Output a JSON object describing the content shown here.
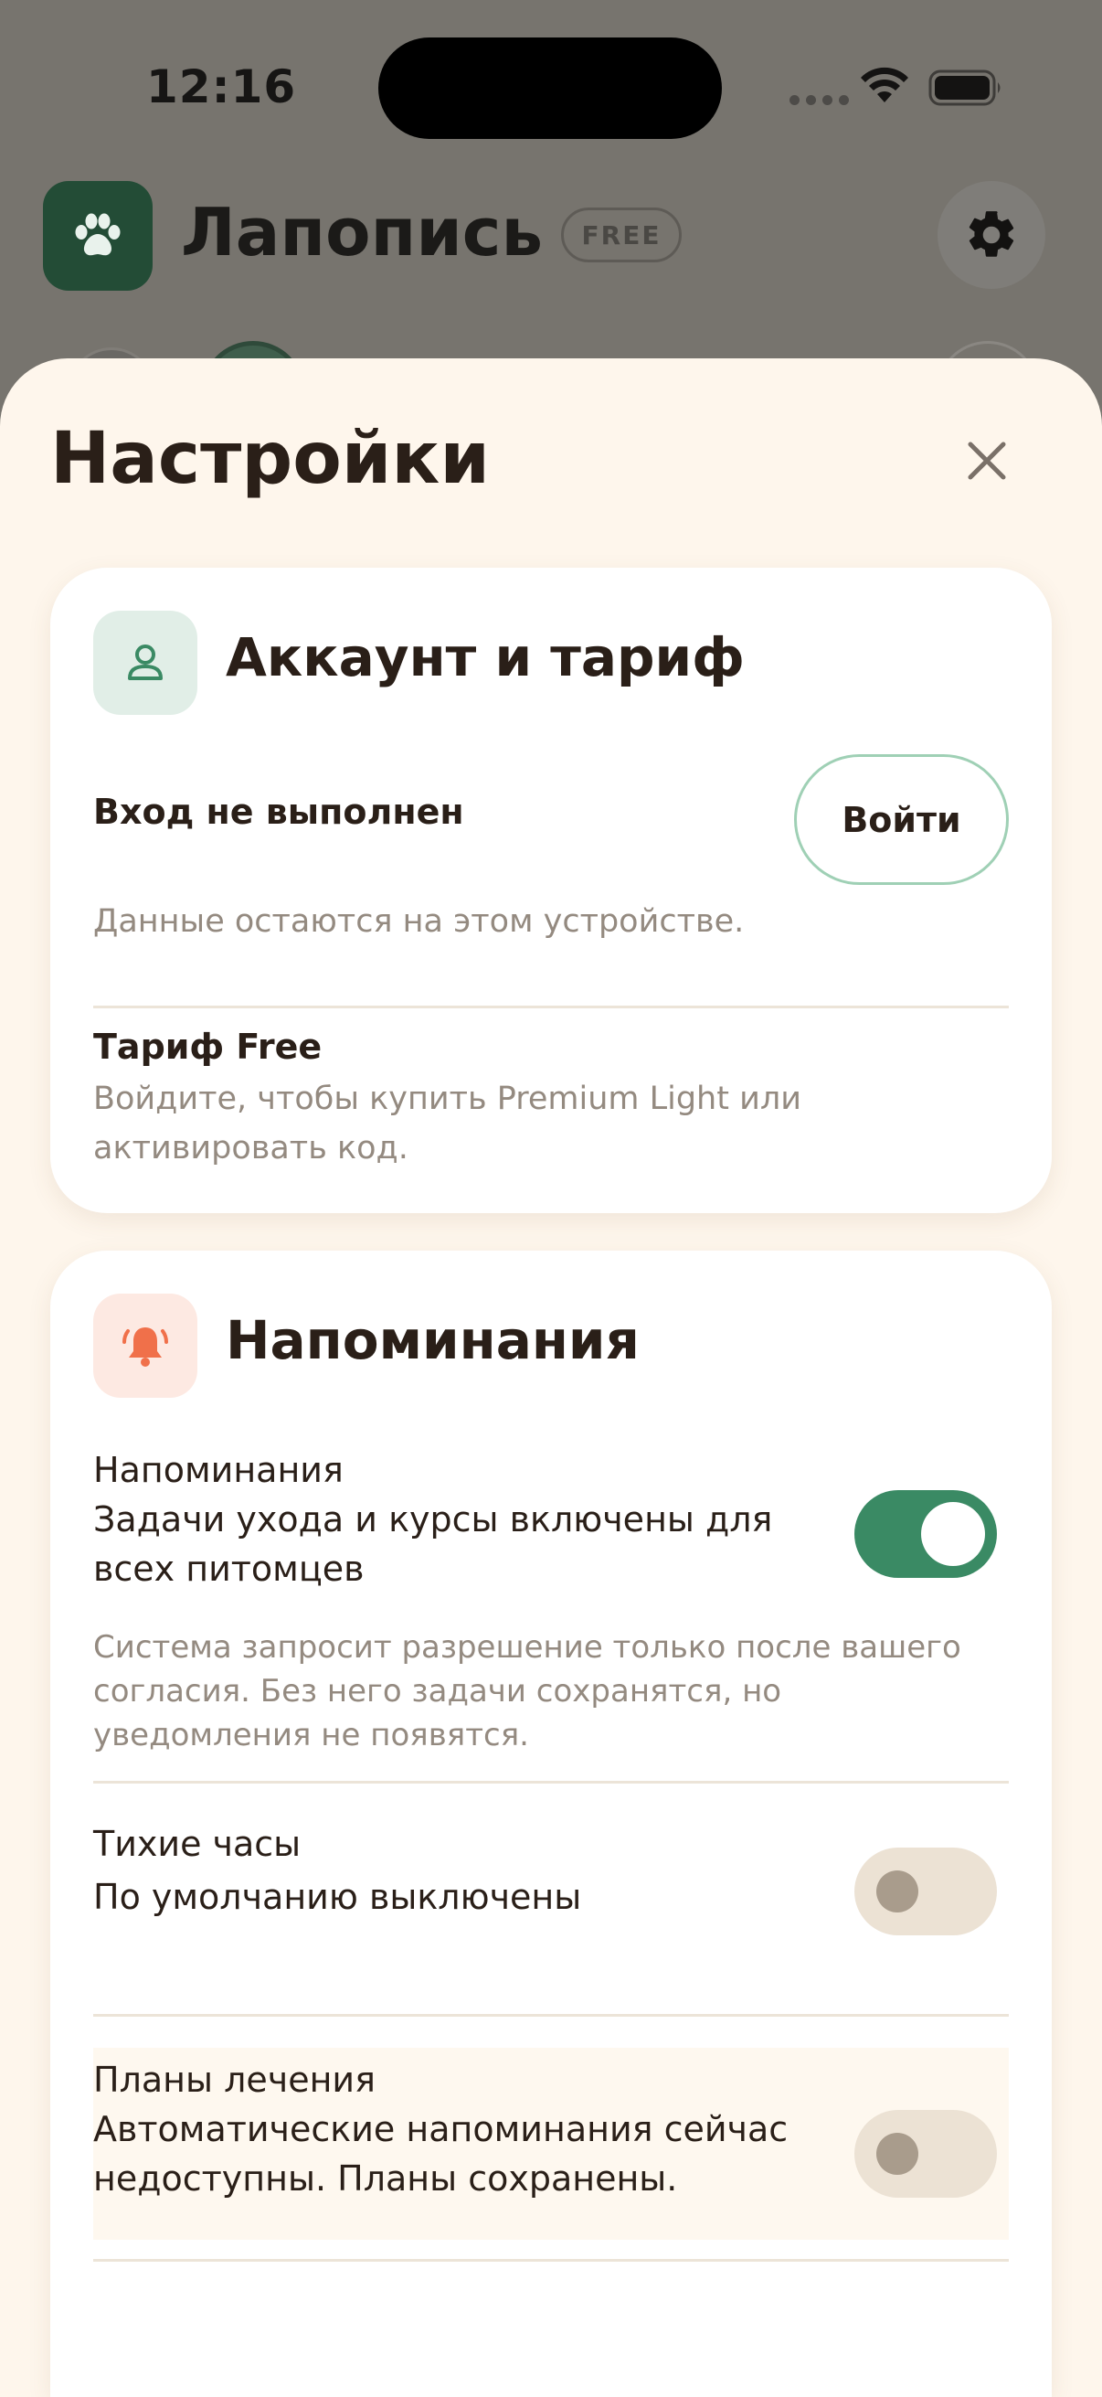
{
  "status_bar": {
    "time": "12:16"
  },
  "app": {
    "title": "Лапопись",
    "plan_badge": "FREE"
  },
  "sheet": {
    "title": "Настройки",
    "account": {
      "heading": "Аккаунт и тариф",
      "login_status": "Вход не выполнен",
      "login_button": "Войти",
      "login_note": "Данные остаются на этом устройстве.",
      "plan_title": "Тариф Free",
      "plan_note_line1": "Войдите, чтобы купить Premium Light или",
      "plan_note_line2": "активировать код."
    },
    "reminders": {
      "heading": "Напоминания",
      "main": {
        "title": "Напоминания",
        "desc_line1": "Задачи ухода и курсы включены для",
        "desc_line2": "всех питомцев",
        "enabled": true
      },
      "permission_note_line1": "Система запросит разрешение только после вашего",
      "permission_note_line2": "согласия. Без него задачи сохранятся, но",
      "permission_note_line3": "уведомления не появятся.",
      "quiet_hours": {
        "title": "Тихие часы",
        "desc": "По умолчанию выключены",
        "enabled": false
      },
      "treatment_plans": {
        "title": "Планы лечения",
        "desc_line1": "Автоматические напоминания сейчас",
        "desc_line2": "недоступны. Планы сохранены.",
        "enabled": false
      }
    }
  },
  "colors": {
    "accent_green": "#3a8a64",
    "reminder_accent": "#f0704a",
    "sheet_background": "#fef6ec"
  },
  "icons": [
    "paw-icon",
    "gear-icon",
    "close-icon",
    "user-icon",
    "bell-icon",
    "wifi-icon",
    "battery-icon"
  ]
}
